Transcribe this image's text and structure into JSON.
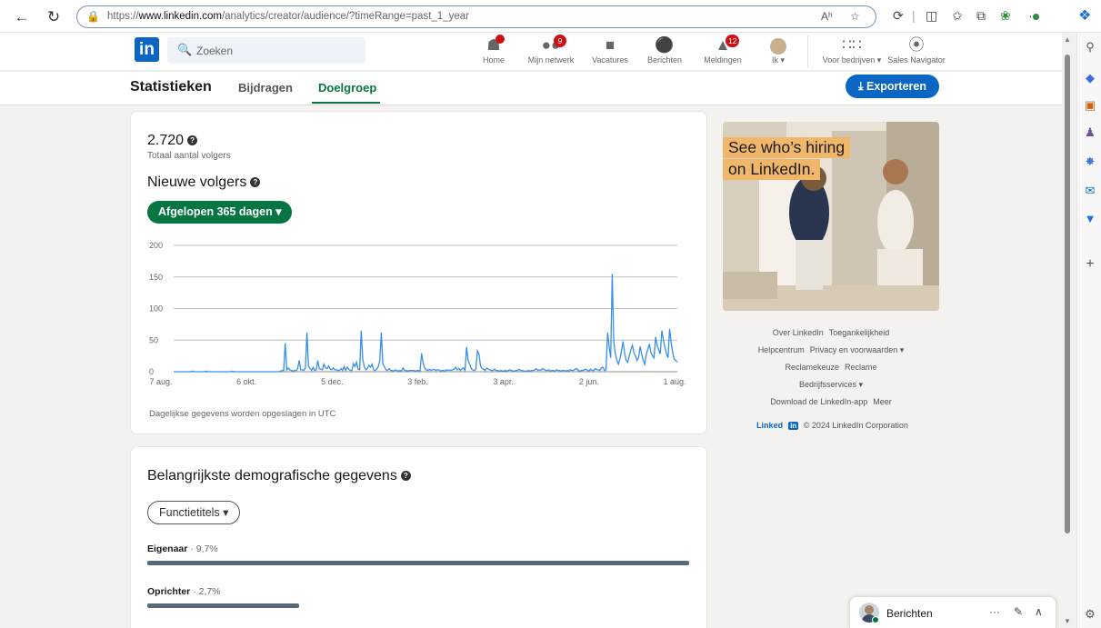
{
  "browser": {
    "url_prefix": "https://",
    "url_host": "www.linkedin.com",
    "url_path": "/analytics/creator/audience/?timeRange=past_1_year",
    "read_aloud": "Aʰ",
    "extensions_badge": "·"
  },
  "header": {
    "logo": "in",
    "search_placeholder": "Zoeken",
    "nav": [
      {
        "label": "Home",
        "icon": "home-icon",
        "badge": ""
      },
      {
        "label": "Mijn netwerk",
        "icon": "network-icon",
        "badge": "9"
      },
      {
        "label": "Vacatures",
        "icon": "briefcase-icon",
        "badge": ""
      },
      {
        "label": "Berichten",
        "icon": "messaging-icon",
        "badge": ""
      },
      {
        "label": "Meldingen",
        "icon": "bell-icon",
        "badge": "12"
      },
      {
        "label": "Ik ▾",
        "icon": "avatar",
        "badge": ""
      },
      {
        "label": "Voor bedrijven ▾",
        "icon": "grid-icon",
        "badge": ""
      },
      {
        "label": "Sales Navigator",
        "icon": "compass-icon",
        "badge": ""
      }
    ]
  },
  "subheader": {
    "title": "Statistieken",
    "tabs": [
      {
        "label": "Bijdragen",
        "active": false
      },
      {
        "label": "Doelgroep",
        "active": true
      }
    ],
    "export_label": "⤓ Exporteren"
  },
  "followers": {
    "total": "2.720",
    "total_label": "Totaal aantal volgers",
    "new_title": "Nieuwe volgers",
    "range_button": "Afgelopen 365 dagen ▾",
    "note": "Dagelijkse gegevens worden opgeslagen in UTC"
  },
  "chart_data": {
    "type": "line",
    "series": [
      {
        "values": [
          0,
          0,
          0,
          0,
          0,
          0,
          0,
          0,
          0,
          0,
          0,
          0,
          1,
          0,
          0,
          0,
          0,
          0,
          0,
          0,
          0,
          1,
          0,
          0,
          0,
          0,
          0,
          0,
          0,
          0,
          0,
          0,
          0,
          0,
          0,
          0,
          0,
          0,
          1,
          0,
          0,
          0,
          0,
          0,
          0,
          0,
          0,
          0,
          0,
          0,
          0,
          0,
          0,
          0,
          0,
          0,
          0,
          0,
          0,
          0,
          0,
          0,
          0,
          0,
          0,
          0,
          0,
          0,
          0,
          1,
          2,
          2,
          45,
          3,
          6,
          3,
          2,
          1,
          2,
          2,
          5,
          18,
          3,
          3,
          2,
          6,
          62,
          8,
          5,
          2,
          7,
          2,
          3,
          18,
          5,
          4,
          3,
          12,
          6,
          5,
          9,
          4,
          3,
          6,
          3,
          3,
          2,
          2,
          5,
          2,
          8,
          2,
          7,
          4,
          2,
          2,
          13,
          8,
          15,
          4,
          3,
          65,
          20,
          8,
          3,
          5,
          10,
          7,
          12,
          3,
          2,
          4,
          8,
          17,
          62,
          12,
          8,
          3,
          2,
          5,
          2,
          2,
          1,
          3,
          2,
          1,
          2,
          1,
          6,
          2,
          2,
          1,
          2,
          2,
          2,
          2,
          1,
          2,
          2,
          1,
          29,
          14,
          6,
          3,
          2,
          4,
          2,
          3,
          4,
          2,
          3,
          3,
          1,
          2,
          2,
          1,
          3,
          2,
          3,
          2,
          3,
          4,
          7,
          3,
          5,
          2,
          5,
          6,
          2,
          39,
          18,
          12,
          5,
          3,
          2,
          4,
          33,
          28,
          9,
          5,
          4,
          2,
          6,
          4,
          3,
          2,
          2,
          4,
          2,
          2,
          1,
          2,
          1,
          1,
          2,
          1,
          2,
          3,
          2,
          1,
          1,
          2,
          2,
          4,
          2,
          2,
          1,
          1,
          1,
          2,
          1,
          2,
          2,
          3,
          5,
          2,
          3,
          2,
          5,
          4,
          2,
          2,
          3,
          1,
          2,
          2,
          1,
          3,
          2,
          2,
          1,
          2,
          2,
          1,
          2,
          1,
          3,
          2,
          2,
          4,
          5,
          2,
          1,
          2,
          2,
          3,
          4,
          2,
          1,
          4,
          2,
          2,
          5,
          3,
          3,
          2,
          6,
          7,
          2,
          3,
          62,
          40,
          22,
          155,
          48,
          28,
          18,
          12,
          20,
          33,
          48,
          30,
          18,
          15,
          25,
          35,
          42,
          30,
          25,
          18,
          22,
          40,
          28,
          18,
          12,
          28,
          36,
          44,
          30,
          25,
          22,
          55,
          42,
          35,
          28,
          65,
          50,
          38,
          28,
          22,
          68,
          46,
          30,
          20,
          18,
          15
        ],
        "color": "#378fe9"
      }
    ],
    "x_tick_labels": [
      "7 aug.",
      "6 okt.",
      "5 dec.",
      "3 feb.",
      "3 apr.",
      "2 jun.",
      "1 aug."
    ],
    "y_ticks": [
      0,
      50,
      100,
      150,
      200
    ],
    "ylim": [
      0,
      200
    ],
    "grid": true,
    "title": "",
    "xlabel": "",
    "ylabel": ""
  },
  "demographics": {
    "title": "Belangrijkste demografische gegevens",
    "filter": "Functietitels ▾",
    "items": [
      {
        "name": "Eigenaar",
        "pct": "· 9,7%",
        "fraction": 1.0
      },
      {
        "name": "Oprichter",
        "pct": "· 2,7%",
        "fraction": 0.28
      }
    ]
  },
  "ad": {
    "line1": "See who’s hiring",
    "line2": "on LinkedIn."
  },
  "footer": {
    "row1": [
      "Over LinkedIn",
      "Toegankelijkheid"
    ],
    "row2": [
      "Helpcentrum",
      "Privacy en voorwaarden ▾"
    ],
    "row3": [
      "Reclamekeuze",
      "Reclame"
    ],
    "row4": [
      "Bedrijfsservices ▾"
    ],
    "row5": [
      "Download de LinkedIn-app",
      "Meer"
    ],
    "brand_word": "Linked",
    "brand_box": "in",
    "copyright": "© 2024 LinkedIn Corporation"
  },
  "messaging": {
    "title": "Berichten",
    "more": "···",
    "compose": "✎",
    "collapse": "∧"
  }
}
